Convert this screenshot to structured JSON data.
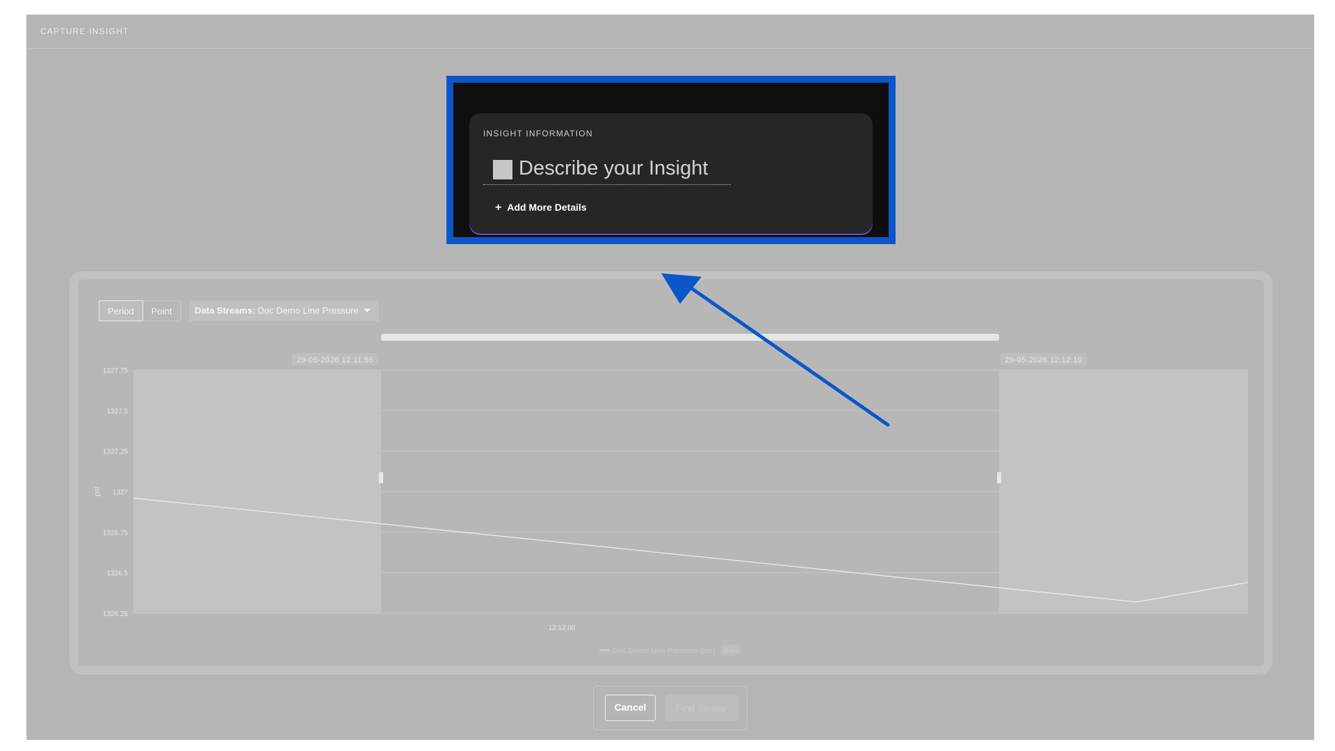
{
  "header": {
    "title": "CAPTURE INSIGHT"
  },
  "insight": {
    "section_label": "INSIGHT INFORMATION",
    "description_placeholder": "Describe your Insight",
    "add_details_label": "Add More Details"
  },
  "controls": {
    "mode_period": "Period",
    "mode_point": "Point",
    "data_streams_label": "Data Streams:",
    "data_streams_value": "Doc Demo Line Pressure"
  },
  "selection": {
    "start_label": "29-05-2026 12:11:55",
    "end_label": "29-05-2026 12:12:10"
  },
  "footer": {
    "cancel_label": "Cancel",
    "find_similar_label": "Find Similar"
  },
  "colors": {
    "accent_blue": "#0b57c9",
    "card_bg": "#262626",
    "frame_bg": "#b5b5b5",
    "focus_purple": "#6a4fd8"
  },
  "chart_data": {
    "type": "line",
    "ylabel": "psi",
    "ylim": [
      1326.25,
      1327.75
    ],
    "yticks": [
      "1327.75",
      "1327.5",
      "1327.25",
      "1327",
      "1326.75",
      "1326.5",
      "1326.25"
    ],
    "xticks": [
      "12:12:00"
    ],
    "legend": {
      "series_name": "Doc Demo Line Pressure (psi)",
      "badge": "Raw",
      "position": "bottom-center"
    },
    "grid": true,
    "series": [
      {
        "name": "Doc Demo Line Pressure (psi)",
        "points": [
          {
            "t": 0.0,
            "v": 1326.96
          },
          {
            "t": 0.9,
            "v": 1326.32
          },
          {
            "t": 1.0,
            "v": 1326.44
          }
        ]
      }
    ]
  }
}
